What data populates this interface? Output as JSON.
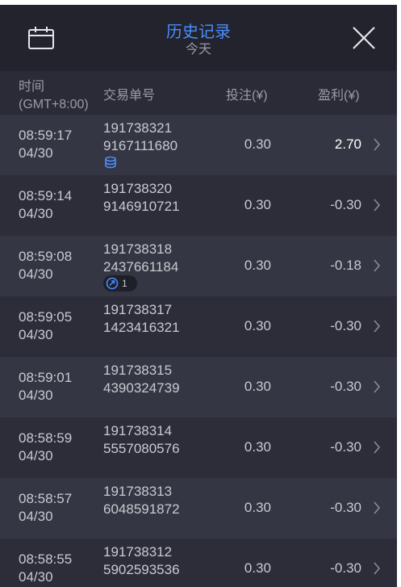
{
  "header": {
    "title": "历史记录",
    "subtitle": "今天",
    "title_color": "#4a8cff"
  },
  "columns": {
    "time_line1": "时间",
    "time_line2": "(GMT+8:00)",
    "order": "交易单号",
    "bet": "投注(¥)",
    "profit": "盈利(¥)"
  },
  "rows": [
    {
      "time": "08:59:17",
      "date": "04/30",
      "order1": "191738321",
      "order2": "9167111680",
      "bet": "0.30",
      "profit": "2.70",
      "badge": "coin-stack-icon"
    },
    {
      "time": "08:59:14",
      "date": "04/30",
      "order1": "191738320",
      "order2": "9146910721",
      "bet": "0.30",
      "profit": "-0.30"
    },
    {
      "time": "08:59:08",
      "date": "04/30",
      "order1": "191738318",
      "order2": "2437661184",
      "bet": "0.30",
      "profit": "-0.18",
      "badge": "free-spin-icon",
      "badge_count": "1"
    },
    {
      "time": "08:59:05",
      "date": "04/30",
      "order1": "191738317",
      "order2": "1423416321",
      "bet": "0.30",
      "profit": "-0.30"
    },
    {
      "time": "08:59:01",
      "date": "04/30",
      "order1": "191738315",
      "order2": "4390324739",
      "bet": "0.30",
      "profit": "-0.30"
    },
    {
      "time": "08:58:59",
      "date": "04/30",
      "order1": "191738314",
      "order2": "5557080576",
      "bet": "0.30",
      "profit": "-0.30"
    },
    {
      "time": "08:58:57",
      "date": "04/30",
      "order1": "191738313",
      "order2": "6048591872",
      "bet": "0.30",
      "profit": "-0.30"
    },
    {
      "time": "08:58:55",
      "date": "04/30",
      "order1": "191738312",
      "order2": "5902593536",
      "bet": "0.30",
      "profit": "-0.30"
    }
  ]
}
